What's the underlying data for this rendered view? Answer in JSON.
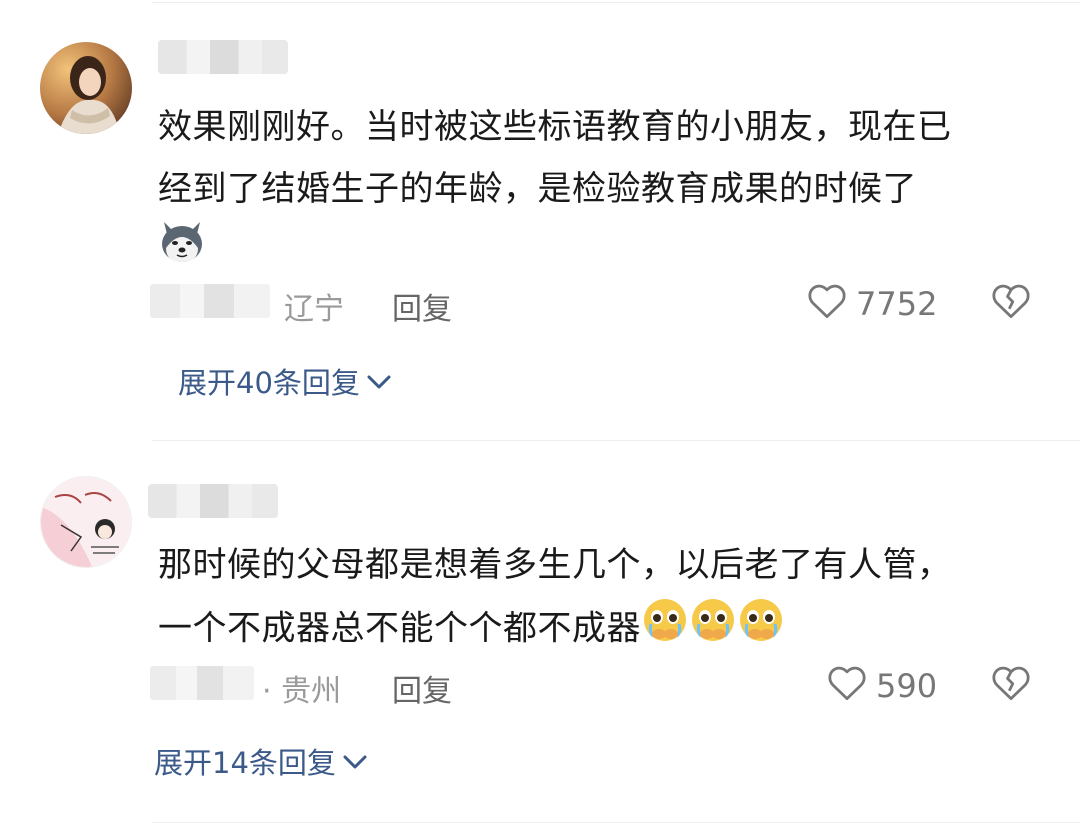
{
  "comments": [
    {
      "text_line1": "效果刚刚好。当时被这些标语教育的小朋友，现在已",
      "text_line2": "经到了结婚生子的年龄，是检验教育成果的时候了",
      "location": "辽宁",
      "reply_label": "回复",
      "likes": "7752",
      "expand_label": "展开40条回复"
    },
    {
      "text_line1": "那时候的父母都是想着多生几个，以后老了有人管，",
      "text_line2": "一个不成器总不能个个都不成器",
      "location": "· 贵州",
      "reply_label": "回复",
      "likes": "590",
      "expand_label": "展开14条回复"
    }
  ],
  "colors": {
    "link": "#3b5a8a",
    "meta": "#9a9a9a",
    "text": "#1a1a1a"
  },
  "icons": [
    "heart-outline-icon",
    "broken-heart-icon",
    "chevron-down-icon",
    "husky-dog-emoji",
    "crying-face-emoji"
  ]
}
